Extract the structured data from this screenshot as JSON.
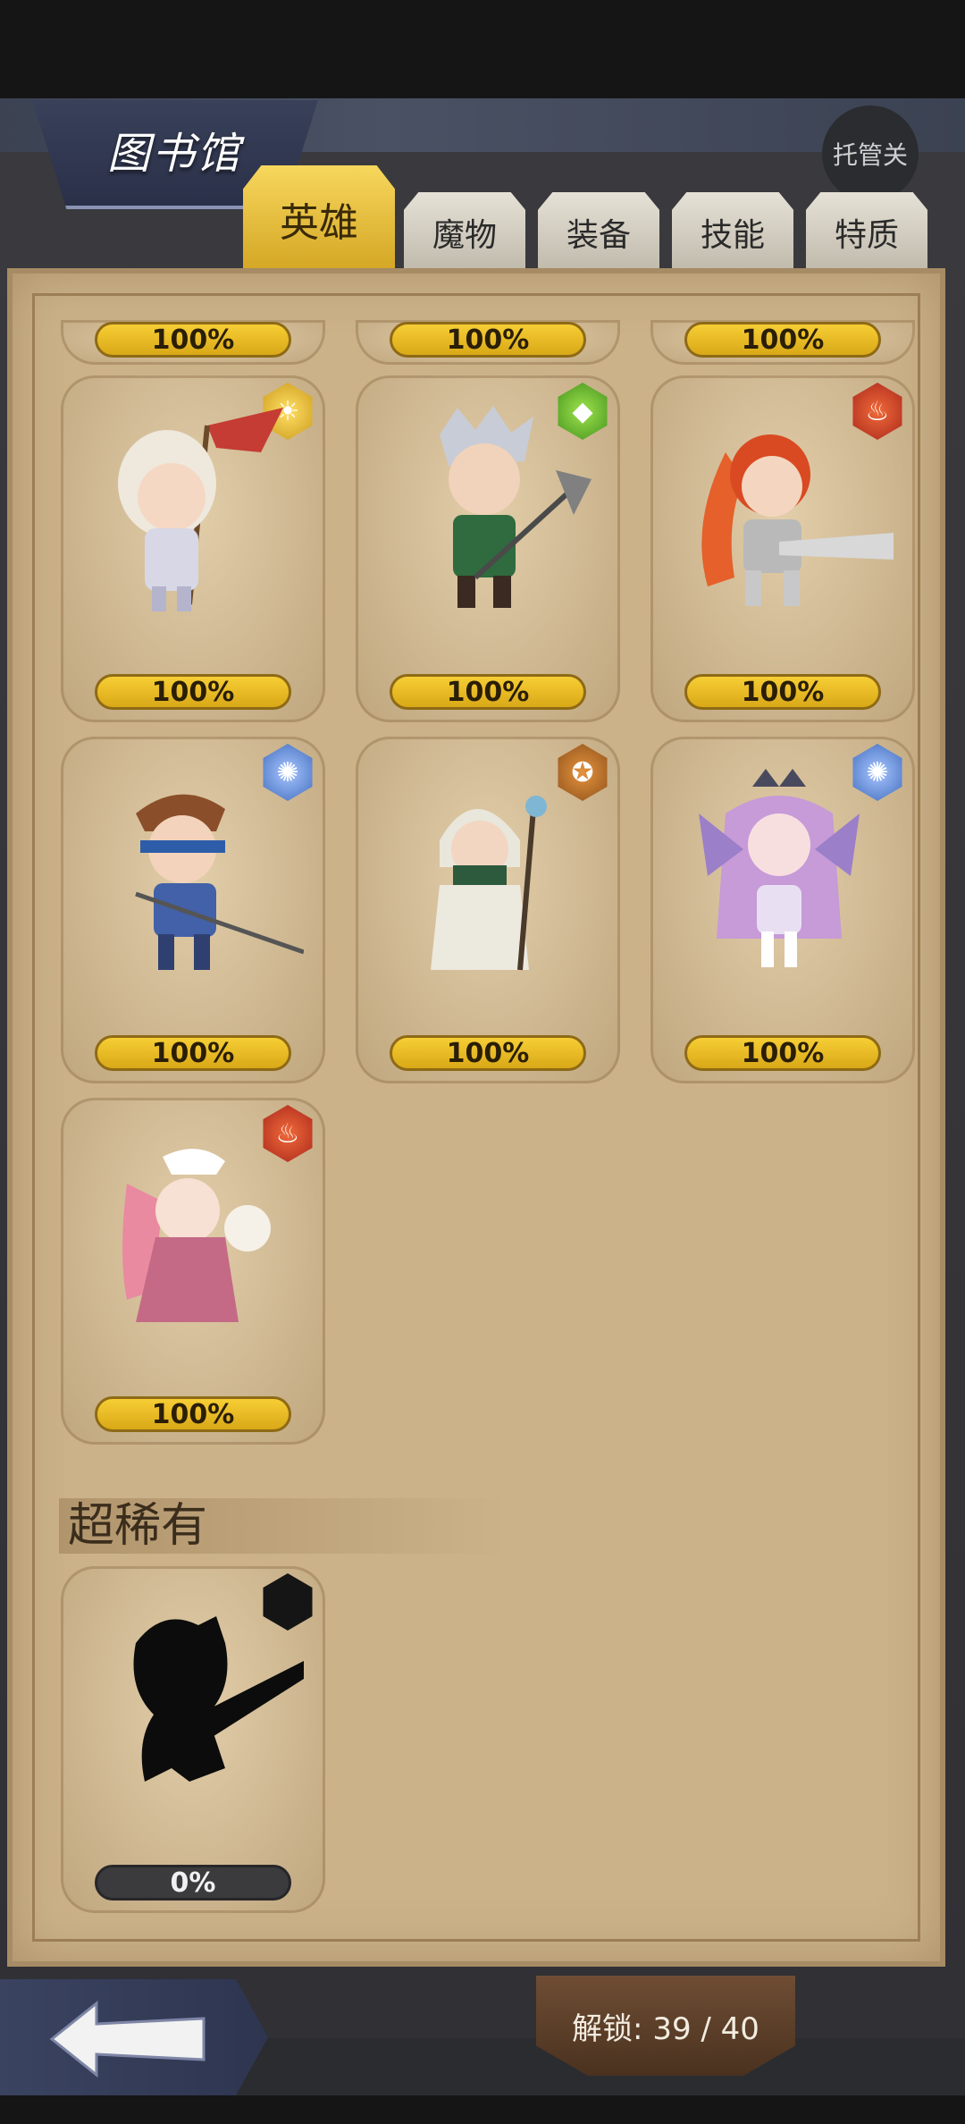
{
  "header": {
    "title": "图书馆",
    "auto_button": "托管关"
  },
  "tabs": [
    {
      "label": "英雄",
      "active": true
    },
    {
      "label": "魔物",
      "active": false
    },
    {
      "label": "装备",
      "active": false
    },
    {
      "label": "技能",
      "active": false
    },
    {
      "label": "特质",
      "active": false
    }
  ],
  "partial_row": [
    "100%",
    "100%",
    "100%"
  ],
  "heroes": [
    {
      "progress": "100%",
      "element": "light-icon"
    },
    {
      "progress": "100%",
      "element": "earth-icon"
    },
    {
      "progress": "100%",
      "element": "fire-icon"
    },
    {
      "progress": "100%",
      "element": "water-icon"
    },
    {
      "progress": "100%",
      "element": "dark-icon"
    },
    {
      "progress": "100%",
      "element": "water-icon"
    },
    {
      "progress": "100%",
      "element": "fire-icon"
    }
  ],
  "super_rare": {
    "heading": "超稀有",
    "items": [
      {
        "progress": "0%",
        "element": "unknown-icon",
        "locked": true
      }
    ]
  },
  "footer": {
    "unlock_label": "解锁: 39 / 40"
  }
}
